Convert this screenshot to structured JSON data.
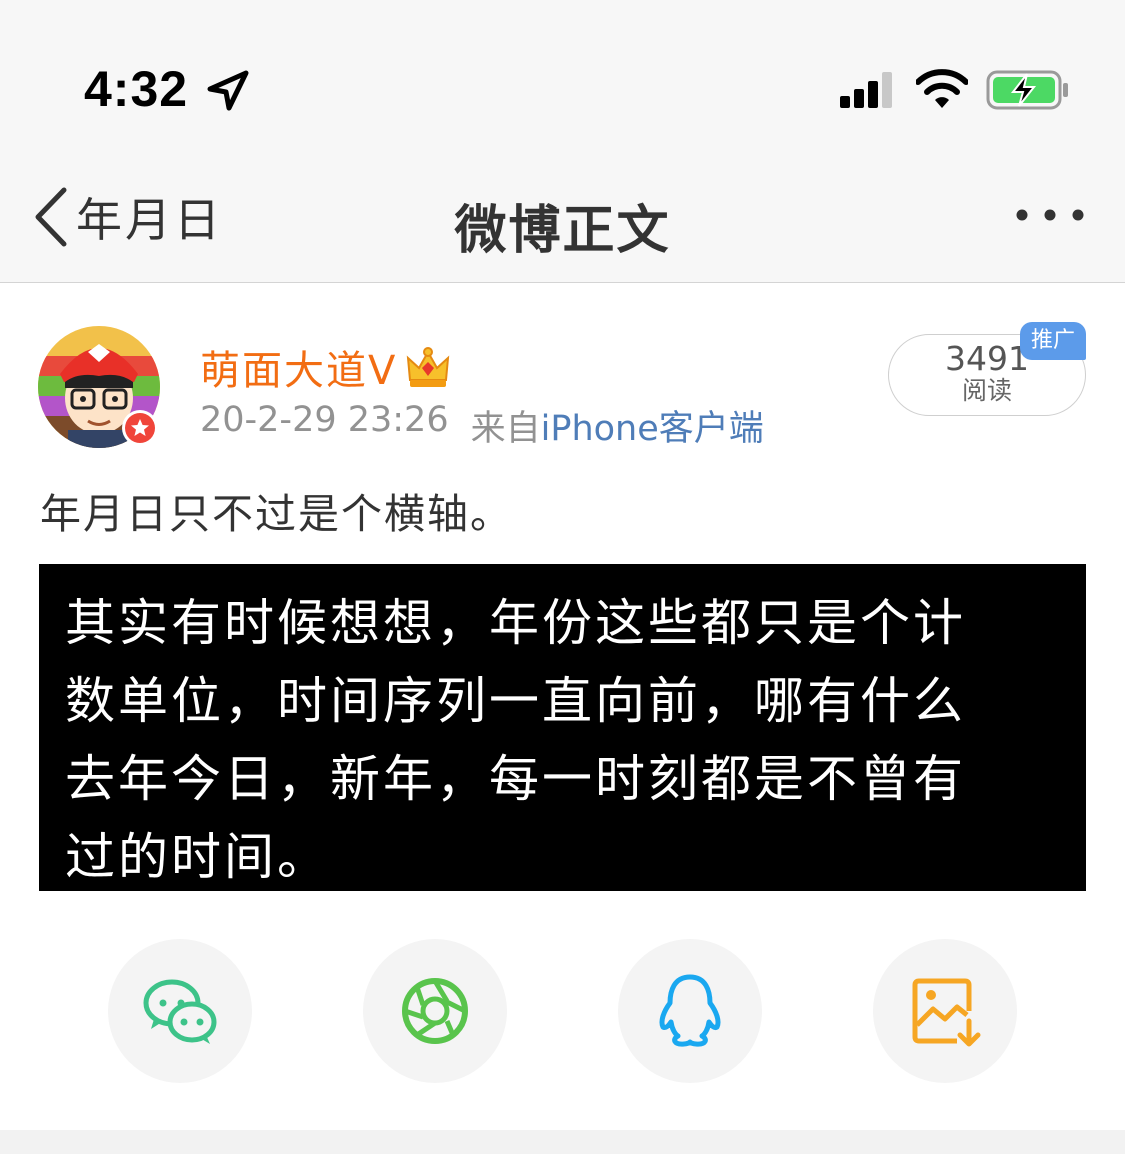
{
  "status_bar": {
    "time": "4:32",
    "icons": [
      "location-arrow-icon",
      "signal-bars-icon",
      "wifi-icon",
      "battery-charging-icon"
    ]
  },
  "nav": {
    "back_label": "年月日",
    "title": "微博正文",
    "more_icon": "more-dots-icon"
  },
  "post": {
    "author": {
      "name": "萌面大道V",
      "badge_icon": "crown-icon"
    },
    "timestamp": "20-2-29 23:26",
    "from_label": "来自",
    "client": "iPhone客户端",
    "reads": {
      "count": "3491",
      "label": "阅读",
      "promo": "推广"
    },
    "text": "年月日只不过是个横轴。",
    "quote_lines": [
      "其实有时候想想，年份这些都只是个计",
      "数单位，时间序列一直向前，哪有什么",
      "去年今日，新年，每一时刻都是不曾有",
      "过的时间。"
    ]
  },
  "share": [
    {
      "name": "wechat",
      "icon": "wechat-icon",
      "color": "#3dc389"
    },
    {
      "name": "moments",
      "icon": "moments-aperture-icon",
      "color": "#59c44c"
    },
    {
      "name": "qq",
      "icon": "qq-penguin-icon",
      "color": "#1aa8f0"
    },
    {
      "name": "save-image",
      "icon": "save-image-icon",
      "color": "#f6a623"
    }
  ],
  "colors": {
    "username": "#f26d13",
    "client_link": "#4f7db8",
    "promo_badge": "#5c9bea"
  }
}
